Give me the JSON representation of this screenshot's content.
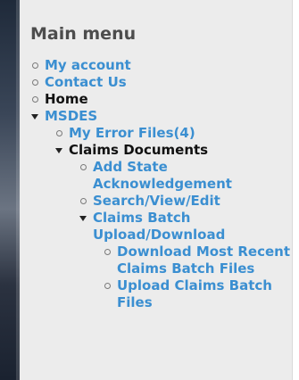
{
  "menu": {
    "title": "Main menu",
    "items": [
      {
        "label": "My account"
      },
      {
        "label": "Contact Us"
      },
      {
        "label": "Home"
      },
      {
        "label": "MSDES",
        "children": [
          {
            "label": "My Error Files(4)"
          },
          {
            "label": "Claims Documents",
            "children": [
              {
                "label": "Add State Acknowledgement"
              },
              {
                "label": "Search/View/Edit"
              },
              {
                "label": "Claims Batch Upload/Download",
                "children": [
                  {
                    "label": "Download Most Recent Claims Batch Files"
                  },
                  {
                    "label": "Upload Claims Batch Files"
                  }
                ]
              }
            ]
          }
        ]
      }
    ]
  }
}
